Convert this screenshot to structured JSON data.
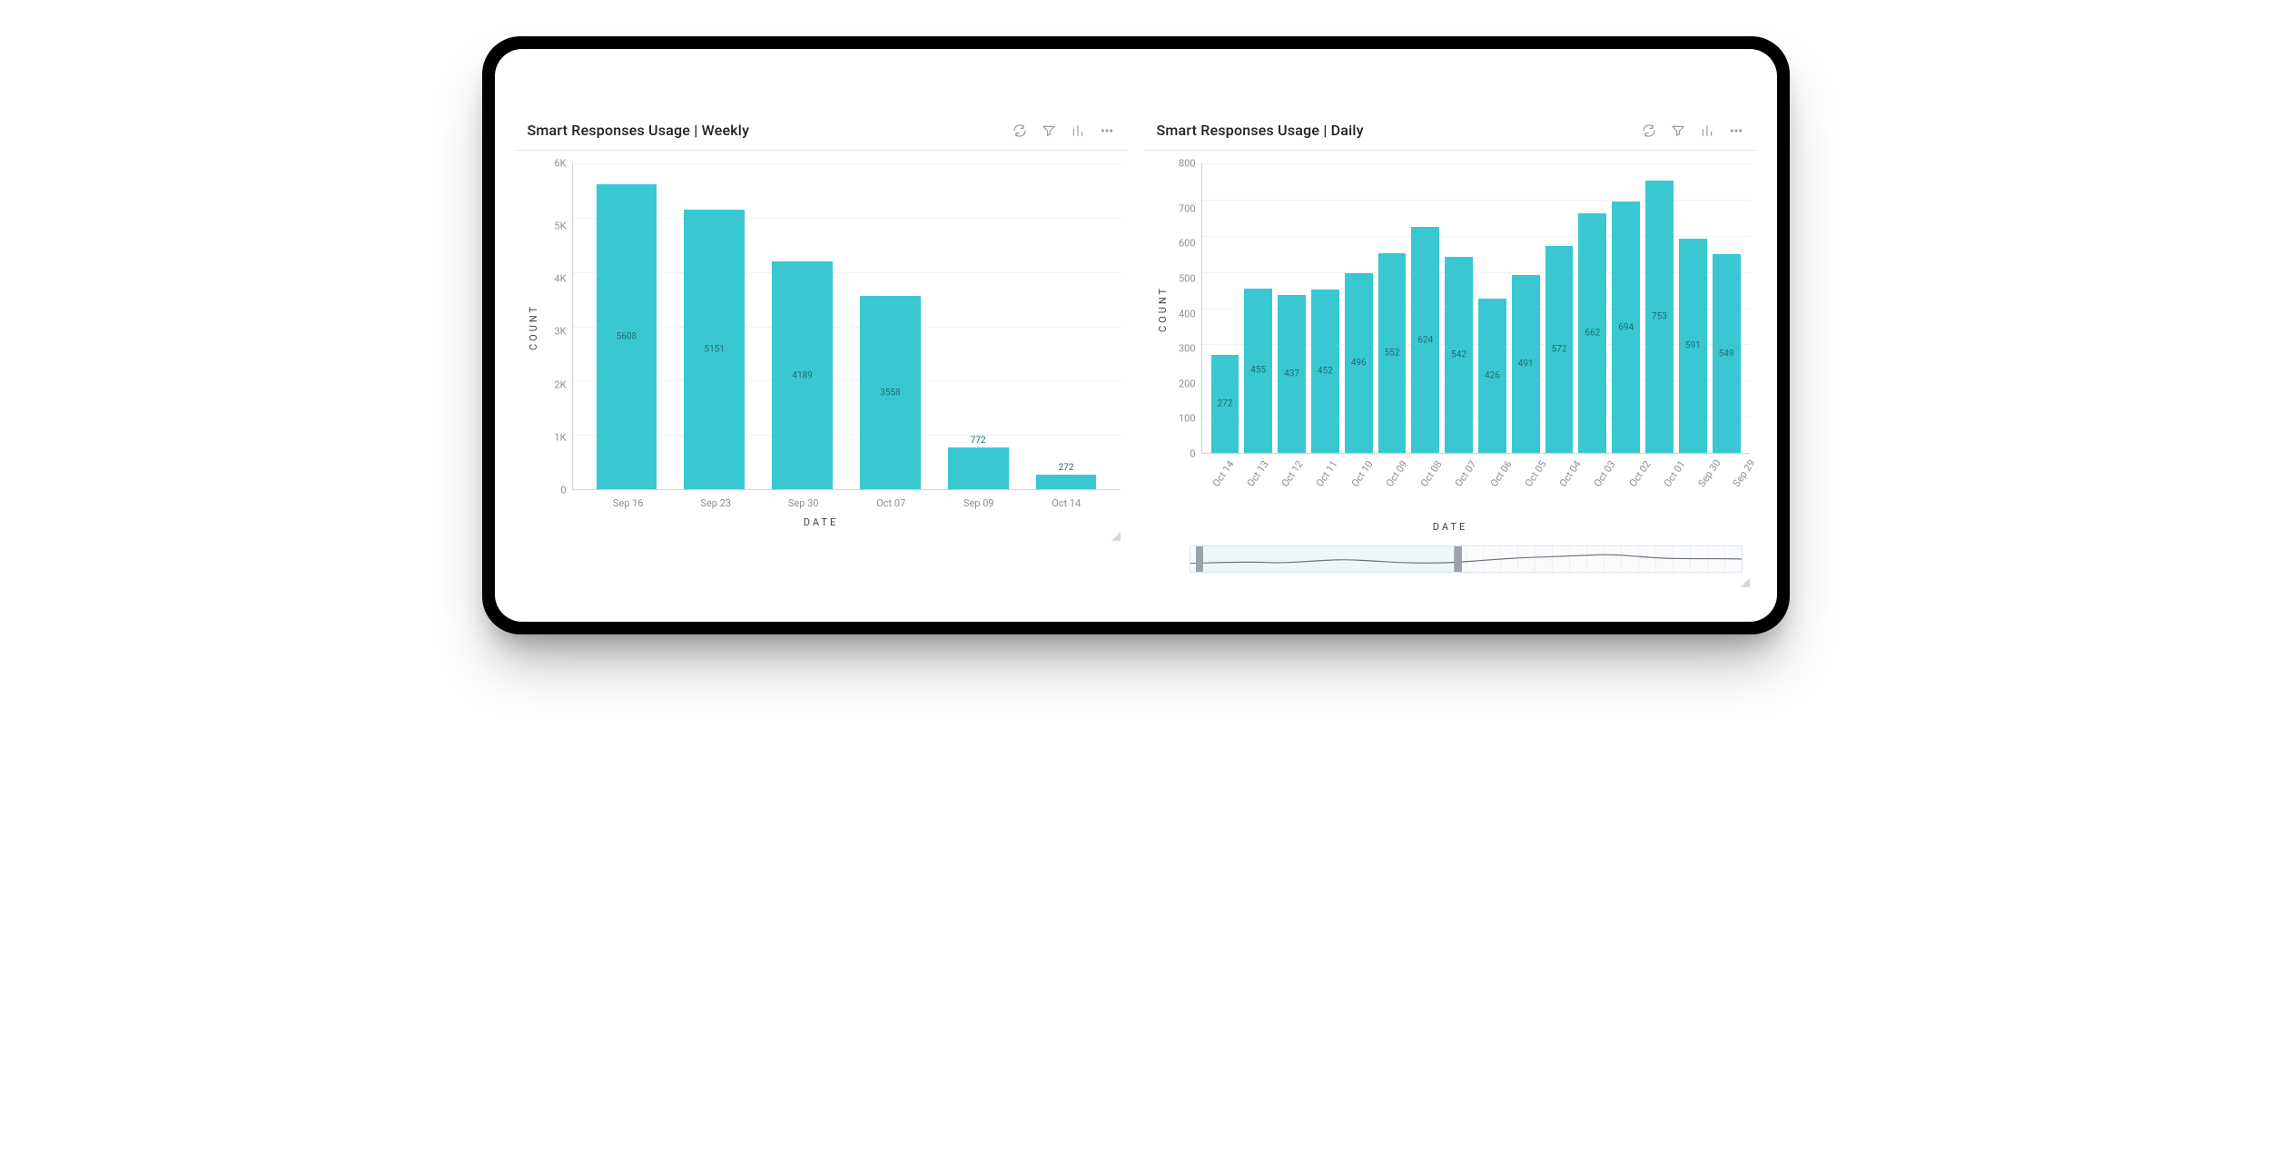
{
  "panels": {
    "weekly": {
      "title": "Smart Responses Usage | Weekly",
      "xlabel": "DATE",
      "ylabel": "COUNT"
    },
    "daily": {
      "title": "Smart Responses Usage | Daily",
      "xlabel": "DATE",
      "ylabel": "COUNT"
    }
  },
  "actions": {
    "refresh": "Refresh",
    "filter": "Filter",
    "viz": "Visualization type",
    "more": "More"
  },
  "chart_data": [
    {
      "id": "weekly",
      "type": "bar",
      "title": "Smart Responses Usage | Weekly",
      "xlabel": "DATE",
      "ylabel": "COUNT",
      "ylim": [
        0,
        6000
      ],
      "ytick_labels": [
        "6K",
        "5K",
        "4K",
        "3K",
        "2K",
        "1K",
        "0"
      ],
      "categories": [
        "Sep 16",
        "Sep 23",
        "Sep 30",
        "Oct 07",
        "Sep 09",
        "Oct 14"
      ],
      "values": [
        5608,
        5151,
        4189,
        3558,
        772,
        272
      ],
      "bar_color": "#39c8d1",
      "rotate_xlabels": false
    },
    {
      "id": "daily",
      "type": "bar",
      "title": "Smart Responses Usage | Daily",
      "xlabel": "DATE",
      "ylabel": "COUNT",
      "ylim": [
        0,
        800
      ],
      "ytick_labels": [
        "800",
        "700",
        "600",
        "500",
        "400",
        "300",
        "200",
        "100",
        "0"
      ],
      "categories": [
        "Oct 14",
        "Oct 13",
        "Oct 12",
        "Oct 11",
        "Oct 10",
        "Oct 09",
        "Oct 08",
        "Oct 07",
        "Oct 06",
        "Oct 05",
        "Oct 04",
        "Oct 03",
        "Oct 02",
        "Oct 01",
        "Sep 30",
        "Sep 29"
      ],
      "values": [
        272,
        455,
        437,
        452,
        496,
        552,
        624,
        542,
        426,
        491,
        572,
        662,
        694,
        753,
        591,
        549
      ],
      "bar_color": "#39c8d1",
      "rotate_xlabels": true,
      "scrubber": true
    }
  ]
}
